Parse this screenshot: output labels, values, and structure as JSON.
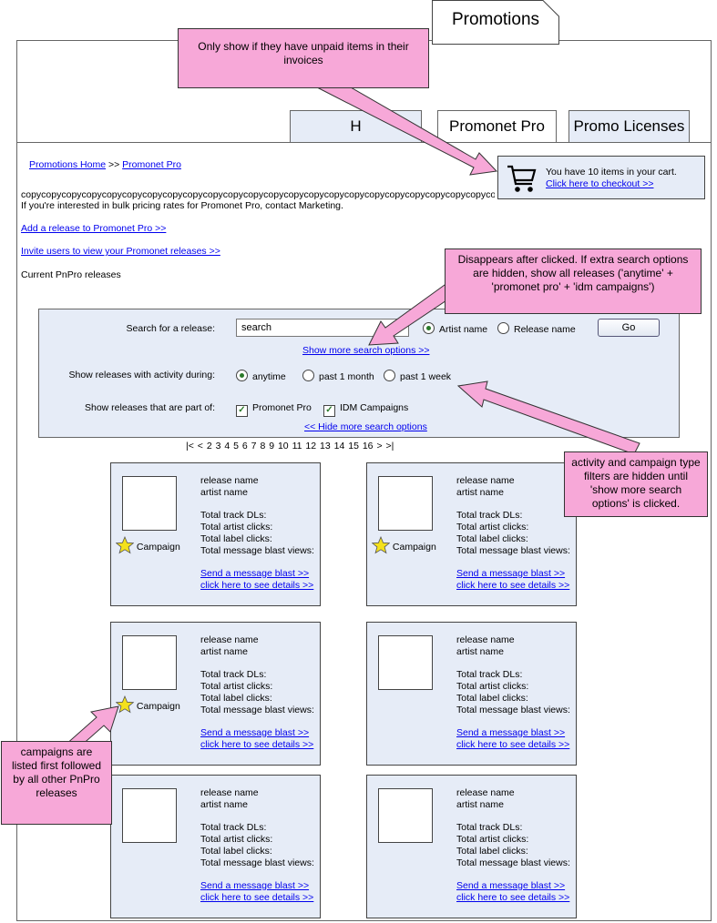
{
  "tabs": {
    "promotions": "Promotions",
    "home_partial": "H",
    "promonet_pro": "Promonet Pro",
    "promo_licenses": "Promo Licenses"
  },
  "breadcrumb": {
    "home": "Promotions Home",
    "sep": ">>",
    "current": "Promonet Pro"
  },
  "cart": {
    "text": "You have 10 items in your cart.",
    "link": "Click here to checkout >>"
  },
  "copy": {
    "line1": "copycopycopycopycopycopycopycopycopycopycopycopycopycopycopycopycopycopycopycopycopycopycopycopy",
    "line2": "If you're interested in bulk pricing rates for Promonet Pro, contact Marketing."
  },
  "links": {
    "add_release": "Add a release to Promonet Pro >>",
    "invite_users": "Invite users to view your Promonet releases >>"
  },
  "section_title": "Current PnPro releases",
  "search": {
    "label": "Search for a release:",
    "value": "search",
    "opt_artist": "Artist name",
    "opt_release": "Release name",
    "go": "Go",
    "show_more": "Show more search options >>",
    "activity_label": "Show releases with activity during:",
    "activity_options": [
      "anytime",
      "past 1 month",
      "past 1 week"
    ],
    "part_label": "Show releases that are part of:",
    "part_options": [
      "Promonet Pro",
      "IDM Campaigns"
    ],
    "hide_more": "<< Hide more search options"
  },
  "pagination": {
    "first": "|<",
    "prev": "<",
    "pages": [
      "2",
      "3",
      "4",
      "5",
      "6",
      "7",
      "8",
      "9",
      "10",
      "11",
      "12",
      "13",
      "14",
      "15",
      "16"
    ],
    "next": ">",
    "last": ">|"
  },
  "card": {
    "release_name": "release name",
    "artist_name": "artist name",
    "track_dls": "Total track DLs:",
    "artist_clicks": "Total artist clicks:",
    "label_clicks": "Total label clicks:",
    "blast_views": "Total message blast views:",
    "send_blast": "Send a message blast >>",
    "see_details": "click here to see details >>",
    "campaign": "Campaign"
  },
  "notes": {
    "unpaid": "Only show if they have unpaid items in their invoices",
    "disappears": "Disappears after clicked.  If extra search options are hidden, show all releases ('anytime' + 'promonet pro' + 'idm campaigns')",
    "filters": "activity and campaign type filters are hidden until 'show more search options' is clicked.",
    "campaigns": "campaigns are listed first followed by all other PnPro releases"
  },
  "colors": {
    "panel": "#e6ecf7",
    "note": "#f7a8d8",
    "link": "#0000ee",
    "star": "#f4e11c"
  }
}
